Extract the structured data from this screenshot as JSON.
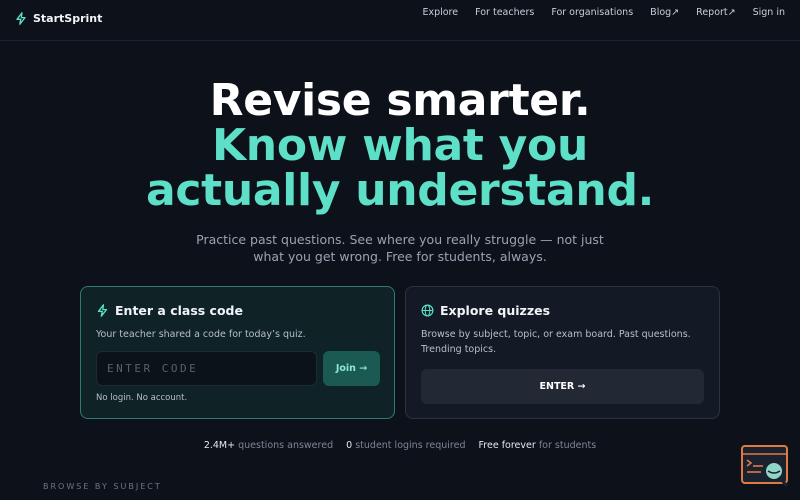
{
  "brand": {
    "name": "StartSprint",
    "icon": "bolt-icon",
    "accent": "#5ee0c8"
  },
  "nav": [
    "Explore",
    "For teachers",
    "For organisations",
    "Blog↗",
    "Report↗",
    "Sign in"
  ],
  "hero": {
    "line1": "Revise smarter.",
    "line2": "Know what you",
    "line3": "actually understand.",
    "subtitle": "Practice past questions. See where you really struggle — not just what you get wrong. Free for students, always."
  },
  "class_code_card": {
    "title": "Enter a class code",
    "icon": "bolt-icon",
    "text": "Your teacher shared a code for today’s quiz.",
    "input_value": "",
    "input_placeholder": "ENTER CODE",
    "join_label": "Join →",
    "note": "No login. No account."
  },
  "explore_card": {
    "title": "Explore quizzes",
    "icon": "globe-icon",
    "text": "Browse by subject, topic, or exam board. Past questions. Trending topics.",
    "button_label": "ENTER →"
  },
  "stats": [
    {
      "value": "2.4M+",
      "label": "questions answered"
    },
    {
      "value": "0",
      "label": "student logins required"
    },
    {
      "value": "Free forever",
      "label": "for students"
    }
  ],
  "browse_label": "BROWSE BY SUBJECT",
  "helper": {
    "icon": "search-help-icon"
  }
}
